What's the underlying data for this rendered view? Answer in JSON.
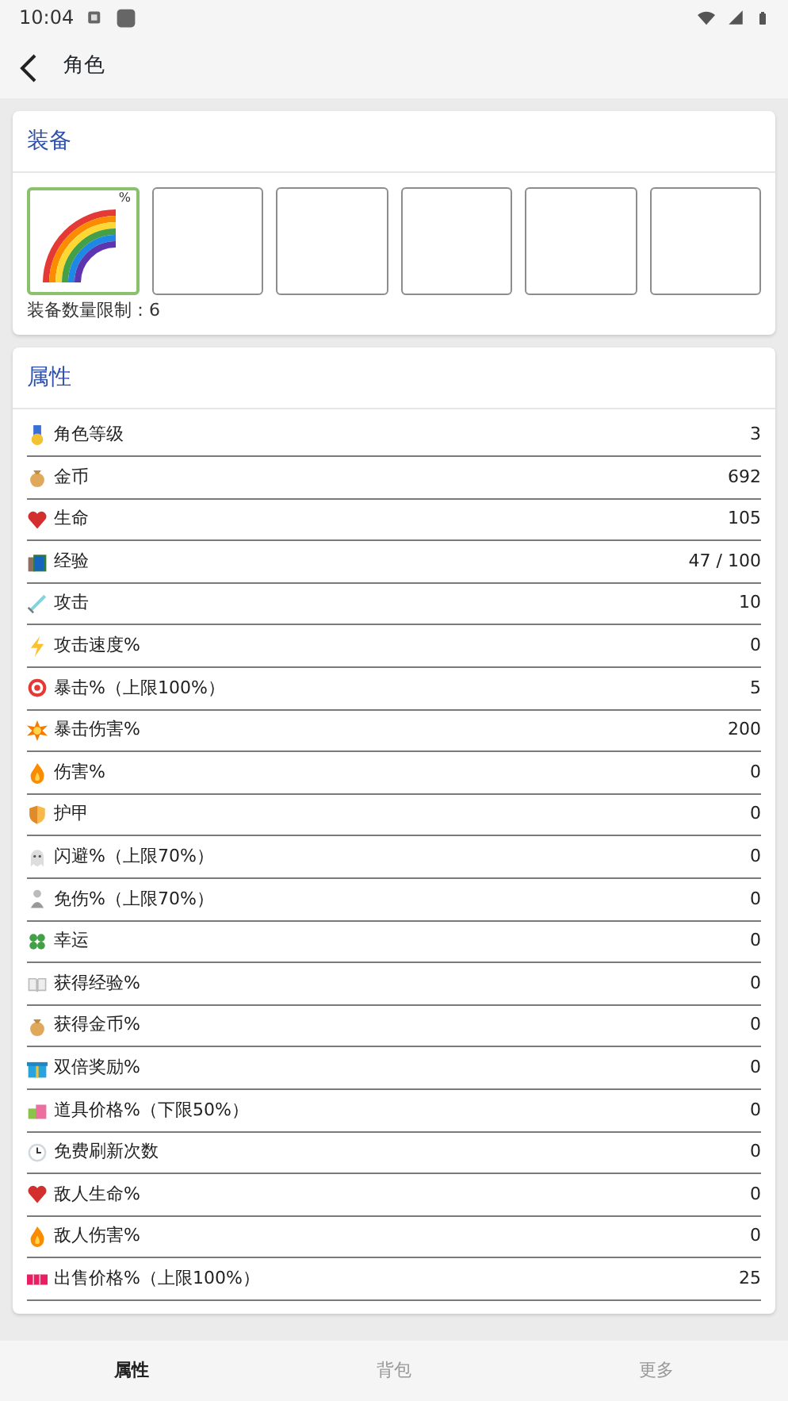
{
  "status_bar": {
    "time": "10:04"
  },
  "app_bar": {
    "title": "角色"
  },
  "equipment": {
    "title": "装备",
    "slots": [
      {
        "filled": true,
        "selected": true,
        "badge": "%"
      },
      {
        "filled": false,
        "selected": false
      },
      {
        "filled": false,
        "selected": false
      },
      {
        "filled": false,
        "selected": false
      },
      {
        "filled": false,
        "selected": false
      },
      {
        "filled": false,
        "selected": false
      }
    ],
    "limit_label": "装备数量限制：6"
  },
  "attributes": {
    "title": "属性",
    "rows": [
      {
        "label": "角色等级",
        "value": "3"
      },
      {
        "label": "金币",
        "value": "692"
      },
      {
        "label": "生命",
        "value": "105"
      },
      {
        "label": "经验",
        "value": "47 / 100"
      },
      {
        "label": "攻击",
        "value": "10"
      },
      {
        "label": "攻击速度%",
        "value": "0"
      },
      {
        "label": "暴击%（上限100%）",
        "value": "5"
      },
      {
        "label": "暴击伤害%",
        "value": "200"
      },
      {
        "label": "伤害%",
        "value": "0"
      },
      {
        "label": "护甲",
        "value": "0"
      },
      {
        "label": "闪避%（上限70%）",
        "value": "0"
      },
      {
        "label": "免伤%（上限70%）",
        "value": "0"
      },
      {
        "label": "幸运",
        "value": "0"
      },
      {
        "label": "获得经验%",
        "value": "0"
      },
      {
        "label": "获得金币%",
        "value": "0"
      },
      {
        "label": "双倍奖励%",
        "value": "0"
      },
      {
        "label": "道具价格%（下限50%）",
        "value": "0"
      },
      {
        "label": "免费刷新次数",
        "value": "0"
      },
      {
        "label": "敌人生命%",
        "value": "0"
      },
      {
        "label": "敌人伤害%",
        "value": "0"
      },
      {
        "label": "出售价格%（上限100%）",
        "value": "25"
      }
    ]
  },
  "bottom_nav": [
    {
      "label": "属性",
      "selected": true
    },
    {
      "label": "背包",
      "selected": false
    },
    {
      "label": "更多",
      "selected": false
    }
  ]
}
